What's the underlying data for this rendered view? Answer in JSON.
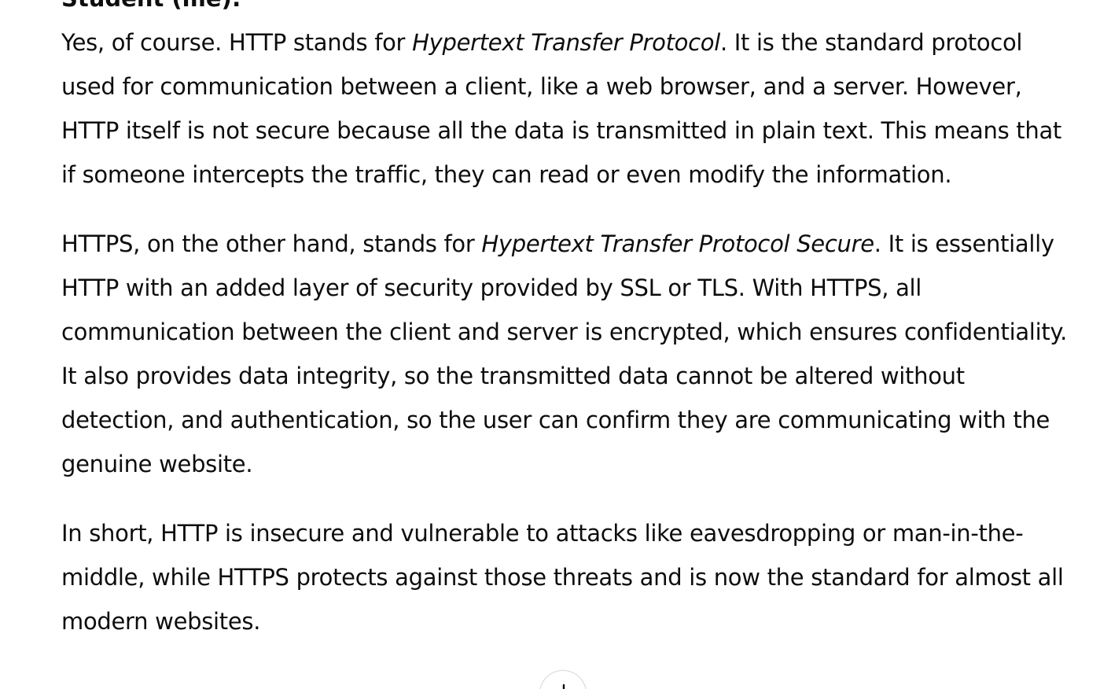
{
  "speaker_label": "Student (me):",
  "paragraphs": [
    {
      "part1": "Yes, of course. HTTP stands for ",
      "em": "Hypertext Transfer Protocol",
      "part2": ". It is the standard protocol used for communication between a client, like a web browser, and a server. However, HTTP itself is not secure because all the data is transmitted in plain text. This means that if someone intercepts the traffic, they can read or even modify the information."
    },
    {
      "part1": "HTTPS, on the other hand, stands for ",
      "em": "Hypertext Transfer Protocol Secure",
      "part2": ". It is essentially HTTP with an added layer of security provided by SSL or TLS. With HTTPS, all communication between the client and server is encrypted, which ensures confidentiality. It also provides data integrity, so the transmitted data cannot be altered without detection, and authentication, so the user can confirm they are communicating with the genuine website."
    },
    {
      "text": "In short, HTTP is insecure and vulnerable to attacks like eavesdropping or man-in-the-middle, while HTTPS protects against those threats and is now the standard for almost all modern websites."
    }
  ],
  "icons": {
    "scroll_down": "arrow-down-icon"
  }
}
